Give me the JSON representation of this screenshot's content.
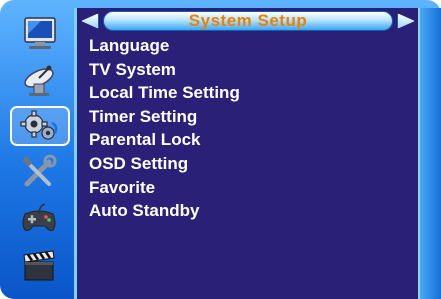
{
  "header": {
    "title": "System Setup"
  },
  "sidebar": {
    "items": [
      {
        "icon": "monitor-icon",
        "selected": false
      },
      {
        "icon": "satellite-dish-icon",
        "selected": false
      },
      {
        "icon": "gears-icon",
        "selected": true
      },
      {
        "icon": "tools-icon",
        "selected": false
      },
      {
        "icon": "gamepad-icon",
        "selected": false
      },
      {
        "icon": "clapperboard-icon",
        "selected": false
      }
    ]
  },
  "menu": {
    "items": [
      "Language",
      "TV System",
      "Local Time Setting",
      "Timer Setting",
      "Parental Lock",
      "OSD Setting",
      "Favorite",
      "Auto Standby"
    ]
  },
  "colors": {
    "panel": "#2a2078",
    "title_text": "#f08000",
    "frame": "#1e78e6",
    "item_text": "#ffffff"
  }
}
